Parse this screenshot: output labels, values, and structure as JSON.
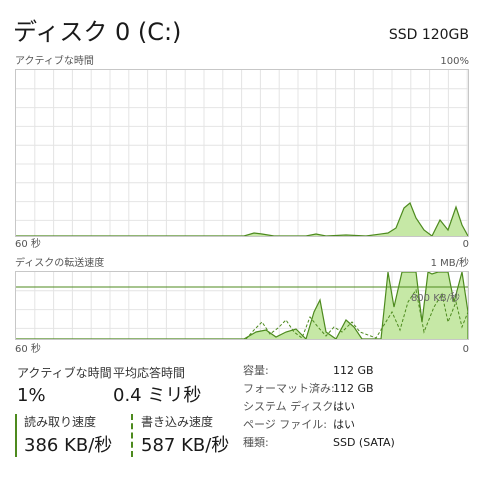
{
  "header": {
    "title": "ディスク 0 (C:)",
    "model": "SSD 120GB"
  },
  "activity_graph": {
    "label": "アクティブな時間",
    "max_label": "100%",
    "x_left_label": "60 秒",
    "x_right_label": "0",
    "color_line": "#4d8a1e",
    "color_fill": "#c6e8a6"
  },
  "transfer_graph": {
    "label": "ディスクの転送速度",
    "max_label": "1 MB/秒",
    "overlay_label": "800 KB/秒",
    "x_left_label": "60 秒",
    "x_right_label": "0"
  },
  "stats": {
    "active_time_label": "アクティブな時間",
    "active_time_value": "1%",
    "response_label": "平均応答時間",
    "response_value": "0.4 ミリ秒",
    "read_label": "読み取り速度",
    "read_value": "386 KB/秒",
    "write_label": "書き込み速度",
    "write_value": "587 KB/秒"
  },
  "info": [
    {
      "label": "容量:",
      "value": "112 GB"
    },
    {
      "label": "フォーマット済み:",
      "value": "112 GB"
    },
    {
      "label": "システム ディスク:",
      "value": "はい"
    },
    {
      "label": "ページ ファイル:",
      "value": "はい"
    },
    {
      "label": "種類:",
      "value": "SSD (SATA)"
    }
  ]
}
